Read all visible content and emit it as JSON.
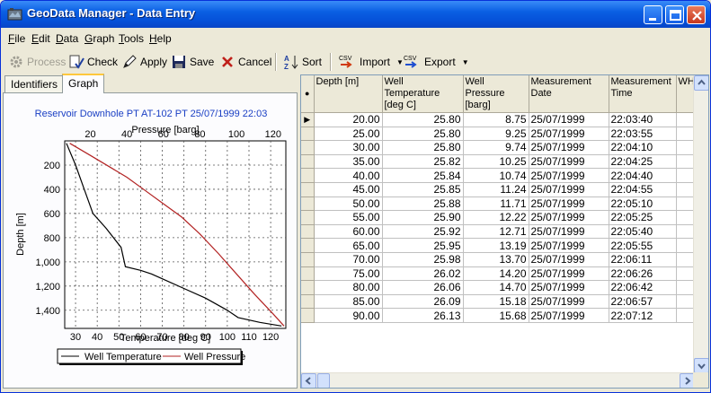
{
  "window": {
    "title": "GeoData Manager - Data Entry"
  },
  "menu": [
    "File",
    "Edit",
    "Data",
    "Graph",
    "Tools",
    "Help"
  ],
  "toolbar": {
    "process": "Process",
    "check": "Check",
    "apply": "Apply",
    "save": "Save",
    "cancel": "Cancel",
    "sort": "Sort",
    "import": "Import",
    "export": "Export",
    "csv_badge": "CSV"
  },
  "tabs": {
    "identifiers": "Identifiers",
    "graph": "Graph"
  },
  "graph": {
    "title": "Reservoir Downhole PT    AT-102 PT 25/07/1999 22:03",
    "top_axis_label": "Pressure [barg]",
    "bottom_axis_label": "Temperature [deg C]",
    "left_axis_label": "Depth [m]",
    "top_ticks": [
      "20",
      "40",
      "60",
      "80",
      "100",
      "120"
    ],
    "bottom_ticks": [
      "30",
      "40",
      "50",
      "60",
      "70",
      "80",
      "90",
      "100",
      "110",
      "120"
    ],
    "left_ticks": [
      "200",
      "400",
      "600",
      "800",
      "1,000",
      "1,200",
      "1,400"
    ],
    "legend": [
      "Well Temperature",
      "Well Pressure"
    ],
    "colors": {
      "temperature": "#000000",
      "pressure": "#b22222",
      "title": "#1a3fc4"
    }
  },
  "chart_data": {
    "type": "line",
    "title": "Reservoir Downhole PT    AT-102 PT 25/07/1999 22:03",
    "ylabel": "Depth [m]",
    "ylim": [
      0,
      1550
    ],
    "y_inverted": true,
    "grid": true,
    "legend_position": "bottom",
    "series": [
      {
        "name": "Well Temperature",
        "axis": "Temperature [deg C]",
        "xlim": [
          25,
          127
        ],
        "x": [
          25.8,
          30,
          34,
          38,
          44,
          51,
          53,
          60,
          65,
          70,
          80,
          90,
          100,
          105,
          115,
          125
        ],
        "y": [
          20,
          200,
          400,
          600,
          720,
          880,
          1040,
          1070,
          1100,
          1140,
          1220,
          1300,
          1400,
          1460,
          1500,
          1530
        ]
      },
      {
        "name": "Well Pressure",
        "axis": "Pressure [barg]",
        "xlim": [
          6,
          127
        ],
        "x": [
          8.75,
          20,
          30,
          40,
          50,
          60,
          70,
          80,
          90,
          100,
          110,
          120,
          126
        ],
        "y": [
          20,
          120,
          210,
          300,
          410,
          520,
          630,
          770,
          930,
          1100,
          1270,
          1430,
          1530
        ]
      }
    ]
  },
  "grid": {
    "columns": [
      "Depth [m]",
      "Well Temperature [deg C]",
      "Well Pressure [barg]",
      "Measurement Date",
      "Measurement Time",
      "WH"
    ],
    "rows": [
      [
        "20.00",
        "25.80",
        "8.75",
        "25/07/1999",
        "22:03:40"
      ],
      [
        "25.00",
        "25.80",
        "9.25",
        "25/07/1999",
        "22:03:55"
      ],
      [
        "30.00",
        "25.80",
        "9.74",
        "25/07/1999",
        "22:04:10"
      ],
      [
        "35.00",
        "25.82",
        "10.25",
        "25/07/1999",
        "22:04:25"
      ],
      [
        "40.00",
        "25.84",
        "10.74",
        "25/07/1999",
        "22:04:40"
      ],
      [
        "45.00",
        "25.85",
        "11.24",
        "25/07/1999",
        "22:04:55"
      ],
      [
        "50.00",
        "25.88",
        "11.71",
        "25/07/1999",
        "22:05:10"
      ],
      [
        "55.00",
        "25.90",
        "12.22",
        "25/07/1999",
        "22:05:25"
      ],
      [
        "60.00",
        "25.92",
        "12.71",
        "25/07/1999",
        "22:05:40"
      ],
      [
        "65.00",
        "25.95",
        "13.19",
        "25/07/1999",
        "22:05:55"
      ],
      [
        "70.00",
        "25.98",
        "13.70",
        "25/07/1999",
        "22:06:11"
      ],
      [
        "75.00",
        "26.02",
        "14.20",
        "25/07/1999",
        "22:06:26"
      ],
      [
        "80.00",
        "26.06",
        "14.70",
        "25/07/1999",
        "22:06:42"
      ],
      [
        "85.00",
        "26.09",
        "15.18",
        "25/07/1999",
        "22:06:57"
      ],
      [
        "90.00",
        "26.13",
        "15.68",
        "25/07/1999",
        "22:07:12"
      ]
    ]
  }
}
